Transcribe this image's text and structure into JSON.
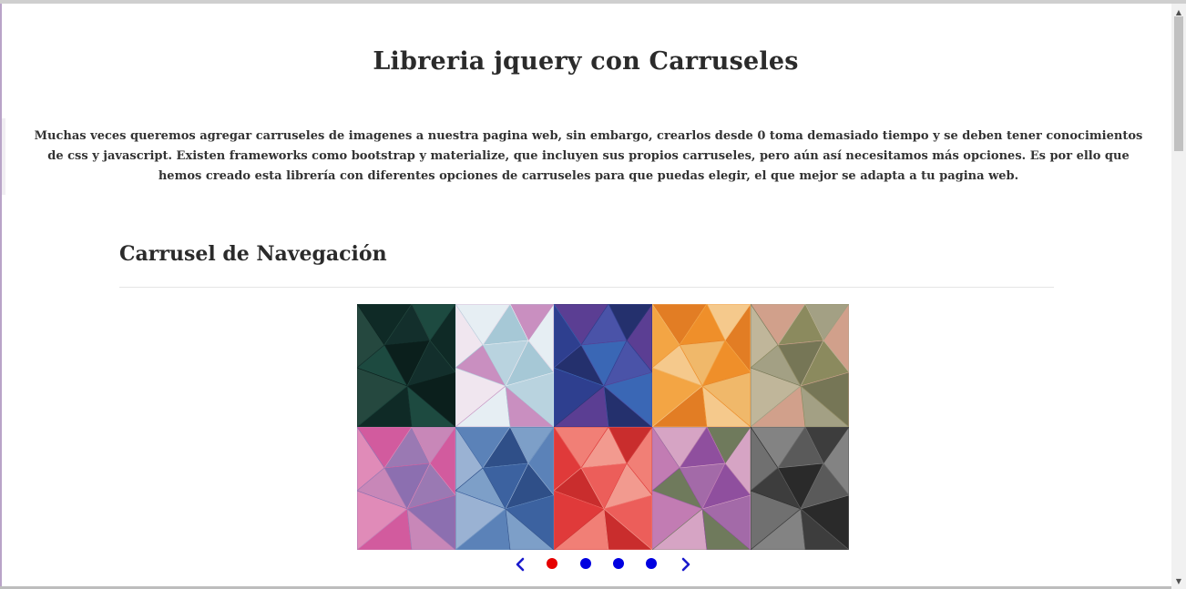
{
  "page": {
    "title": "Libreria jquery con Carruseles",
    "intro": "Muchas veces queremos agregar carruseles de imagenes a nuestra pagina web, sin embargo, crearlos desde 0 toma demasiado tiempo y se deben tener conocimientos de css y javascript. Existen frameworks como bootstrap y materialize, que incluyen sus propios carruseles, pero aún así necesitamos más opciones. Es por ello que hemos creado esta librería con diferentes opciones de carruseles para que puedas elegir, el que mejor se adapta a tu pagina web."
  },
  "section": {
    "title": "Carrusel de Navegación"
  },
  "carousel": {
    "slides": [
      {
        "name": "dark-green-polygon",
        "colors": [
          "#0f2a26",
          "#1d4a40",
          "#132f2c",
          "#25483f",
          "#0b1f1c"
        ]
      },
      {
        "name": "pastel-polygon",
        "colors": [
          "#b9d3df",
          "#e6eef3",
          "#c98fc0",
          "#a6c8d6",
          "#f0e6ef"
        ]
      },
      {
        "name": "blue-purple-polygon",
        "colors": [
          "#2e3f8f",
          "#3a67b5",
          "#5b3e93",
          "#24306d",
          "#4a53a8"
        ]
      },
      {
        "name": "orange-polygon",
        "colors": [
          "#ef8f2a",
          "#f3a544",
          "#f0b86a",
          "#e27d24",
          "#f5c98c"
        ]
      },
      {
        "name": "olive-polygon",
        "colors": [
          "#a3a084",
          "#8b8a5e",
          "#c0b69a",
          "#767656",
          "#d1a08b"
        ]
      },
      {
        "name": "pink-polygon",
        "colors": [
          "#d25b9e",
          "#c887b8",
          "#9a79b3",
          "#e08bb8",
          "#8c6fb0"
        ]
      },
      {
        "name": "steel-blue-polygon",
        "colors": [
          "#3c62a0",
          "#5b82b8",
          "#7d9fc8",
          "#2f4f88",
          "#9ab2d3"
        ]
      },
      {
        "name": "red-polygon",
        "colors": [
          "#e03a3a",
          "#ec5e5a",
          "#f17f76",
          "#c92d2d",
          "#f29a8f"
        ]
      },
      {
        "name": "violet-polygon",
        "colors": [
          "#8f4f9e",
          "#c27cb3",
          "#a36aa8",
          "#d6a4c4",
          "#6f7a5c"
        ]
      },
      {
        "name": "gray-polygon",
        "colors": [
          "#3d3d3d",
          "#5a5a5a",
          "#707070",
          "#2a2a2a",
          "#838383"
        ]
      }
    ],
    "dots": [
      {
        "state": "active",
        "color": "#e60000"
      },
      {
        "state": "inactive",
        "color": "#0000e0"
      },
      {
        "state": "inactive",
        "color": "#0000e0"
      },
      {
        "state": "inactive",
        "color": "#0000e0"
      }
    ],
    "arrow_color": "#1a1acc",
    "prev_icon": "chevron-left-icon",
    "next_icon": "chevron-right-icon"
  }
}
